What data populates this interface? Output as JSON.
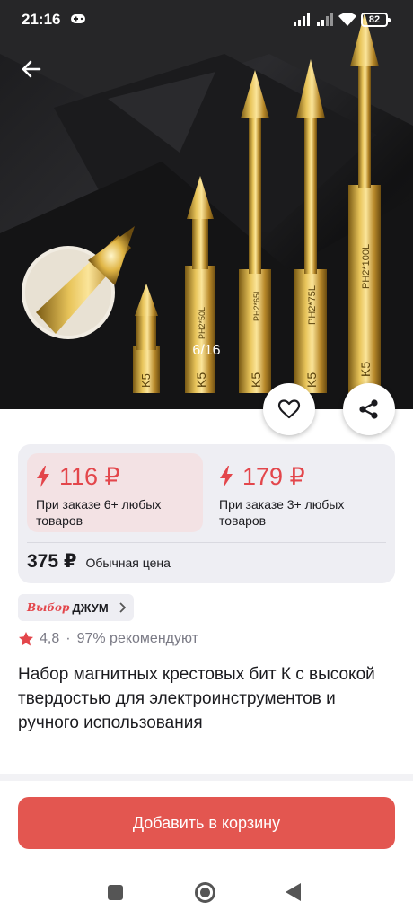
{
  "status_bar": {
    "time": "21:16",
    "battery": "82",
    "icons": [
      "game-controller-icon",
      "signal-icon",
      "signal-icon",
      "wifi-icon",
      "battery-icon"
    ]
  },
  "gallery": {
    "counter": "6/16",
    "bit_labels": [
      "K5",
      "K5",
      "K5",
      "K5",
      "K5"
    ],
    "bit_markings": [
      "PH2*50L",
      "PH2*65L",
      "PH2*75L",
      "PH2*100L"
    ],
    "icons": [
      "back-arrow-icon",
      "heart-icon",
      "share-icon"
    ]
  },
  "price_card": {
    "offers": [
      {
        "price": "116 ₽",
        "text": "При заказе 6+ любых товаров",
        "highlighted": true
      },
      {
        "price": "179 ₽",
        "text": "При заказе 3+ любых товаров",
        "highlighted": false
      }
    ],
    "regular_price": "375 ₽",
    "regular_label": "Обычная цена",
    "accent_color": "#e3464b"
  },
  "badge": {
    "brand": "Выбор",
    "text": "ДЖУМ"
  },
  "rating": {
    "value": "4,8",
    "separator": "·",
    "recommend": "97% рекомендуют"
  },
  "product": {
    "title": "Набор магнитных крестовых бит К с высокой твердостью для электроинструментов и ручного использования"
  },
  "cta": {
    "label": "Добавить в корзину",
    "color": "#e35650"
  }
}
